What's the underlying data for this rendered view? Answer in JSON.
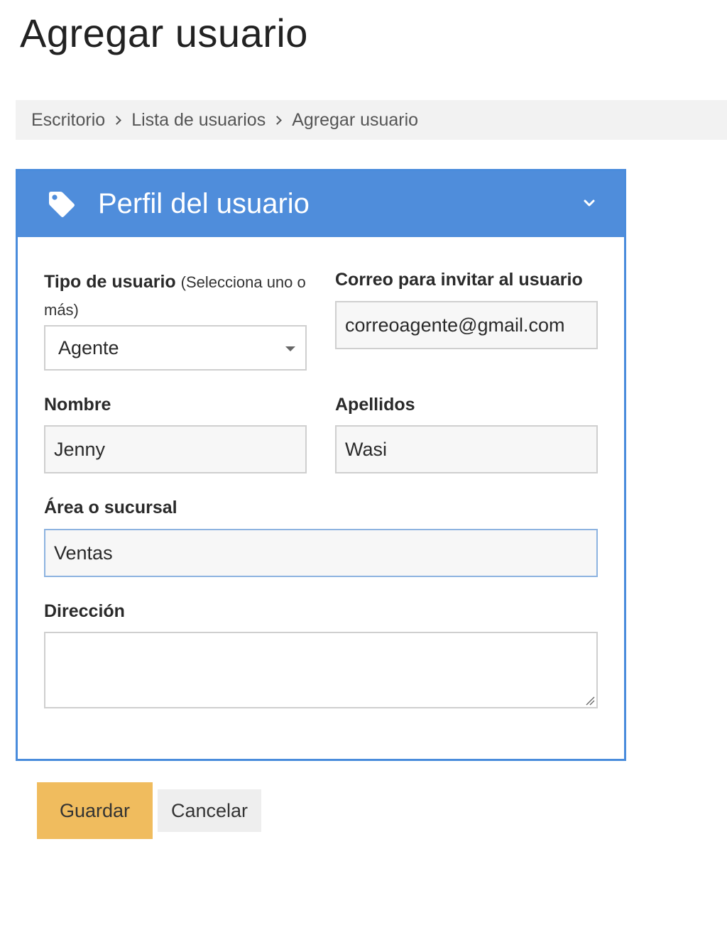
{
  "page": {
    "title": "Agregar usuario"
  },
  "breadcrumb": {
    "items": [
      "Escritorio",
      "Lista de usuarios",
      "Agregar usuario"
    ]
  },
  "panel": {
    "title": "Perfil del usuario",
    "header_color": "#4f8ddb",
    "icon": "tag-icon",
    "toggle_icon": "chevron-down-icon"
  },
  "form": {
    "user_type": {
      "label": "Tipo de usuario",
      "hint": "(Selecciona uno o más)",
      "value": "Agente"
    },
    "email": {
      "label": "Correo para invitar al usuario",
      "value": "correoagente@gmail.com"
    },
    "first_name": {
      "label": "Nombre",
      "value": "Jenny"
    },
    "last_name": {
      "label": "Apellidos",
      "value": "Wasi"
    },
    "area": {
      "label": "Área o sucursal",
      "value": "Ventas"
    },
    "address": {
      "label": "Dirección",
      "value": ""
    }
  },
  "actions": {
    "save_label": "Guardar",
    "cancel_label": "Cancelar",
    "save_color": "#f0bc5e"
  }
}
